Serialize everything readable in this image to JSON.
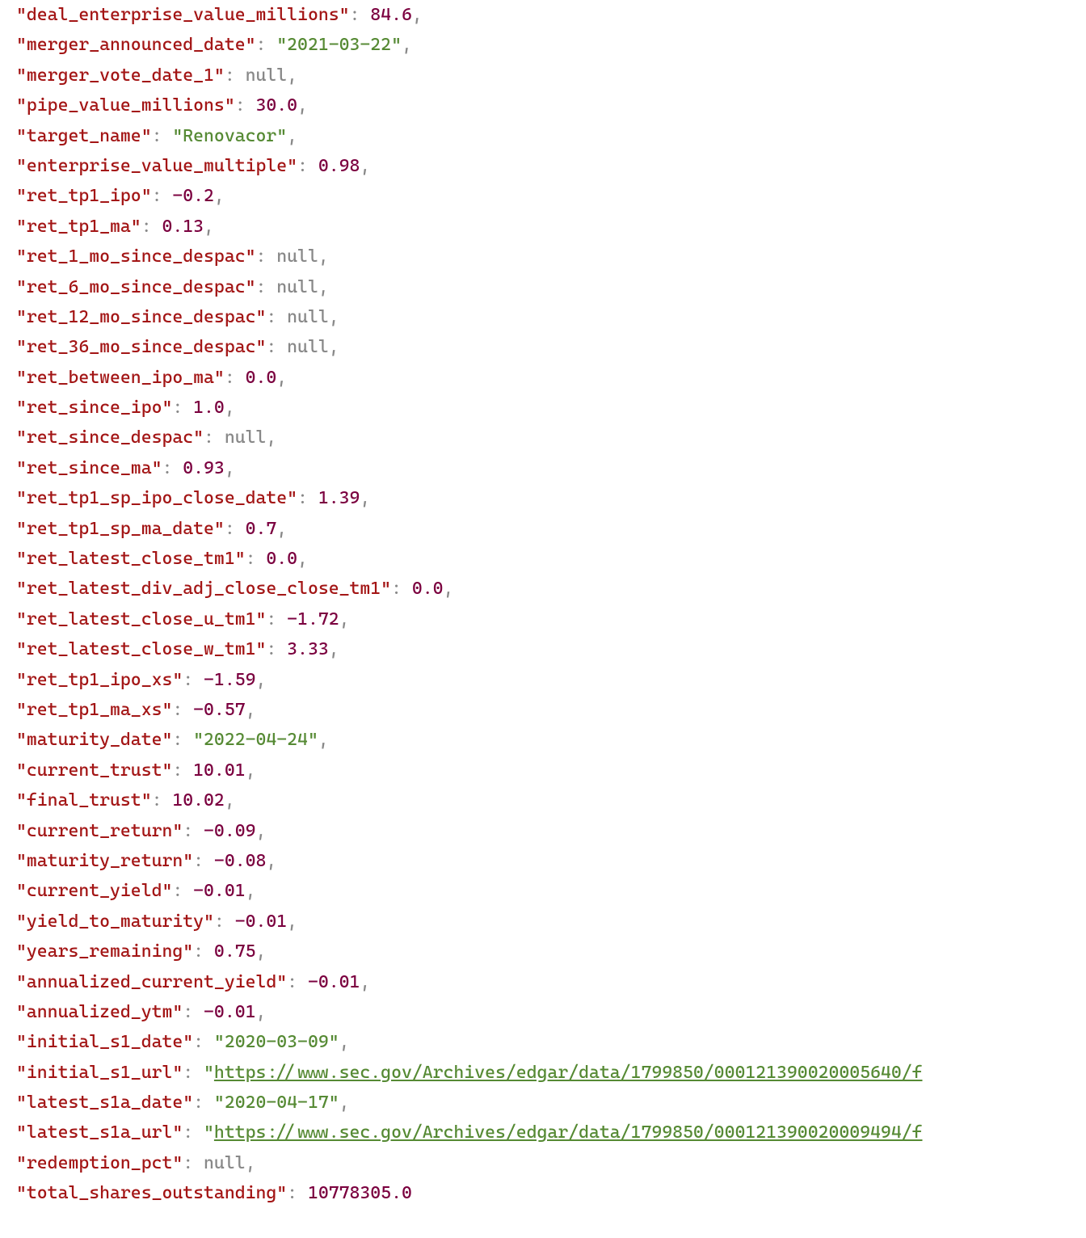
{
  "entries": [
    {
      "key": "deal_enterprise_value_millions",
      "type": "num",
      "value": "84.6",
      "comma": true
    },
    {
      "key": "merger_announced_date",
      "type": "str",
      "value": "2021-03-22",
      "comma": true
    },
    {
      "key": "merger_vote_date_1",
      "type": "null",
      "value": "null",
      "comma": true
    },
    {
      "key": "pipe_value_millions",
      "type": "num",
      "value": "30.0",
      "comma": true
    },
    {
      "key": "target_name",
      "type": "str",
      "value": "Renovacor",
      "comma": true
    },
    {
      "key": "enterprise_value_multiple",
      "type": "num",
      "value": "0.98",
      "comma": true
    },
    {
      "key": "ret_tp1_ipo",
      "type": "num",
      "value": "-0.2",
      "comma": true
    },
    {
      "key": "ret_tp1_ma",
      "type": "num",
      "value": "0.13",
      "comma": true
    },
    {
      "key": "ret_1_mo_since_despac",
      "type": "null",
      "value": "null",
      "comma": true
    },
    {
      "key": "ret_6_mo_since_despac",
      "type": "null",
      "value": "null",
      "comma": true
    },
    {
      "key": "ret_12_mo_since_despac",
      "type": "null",
      "value": "null",
      "comma": true
    },
    {
      "key": "ret_36_mo_since_despac",
      "type": "null",
      "value": "null",
      "comma": true
    },
    {
      "key": "ret_between_ipo_ma",
      "type": "num",
      "value": "0.0",
      "comma": true
    },
    {
      "key": "ret_since_ipo",
      "type": "num",
      "value": "1.0",
      "comma": true
    },
    {
      "key": "ret_since_despac",
      "type": "null",
      "value": "null",
      "comma": true
    },
    {
      "key": "ret_since_ma",
      "type": "num",
      "value": "0.93",
      "comma": true
    },
    {
      "key": "ret_tp1_sp_ipo_close_date",
      "type": "num",
      "value": "1.39",
      "comma": true
    },
    {
      "key": "ret_tp1_sp_ma_date",
      "type": "num",
      "value": "0.7",
      "comma": true
    },
    {
      "key": "ret_latest_close_tm1",
      "type": "num",
      "value": "0.0",
      "comma": true
    },
    {
      "key": "ret_latest_div_adj_close_close_tm1",
      "type": "num",
      "value": "0.0",
      "comma": true
    },
    {
      "key": "ret_latest_close_u_tm1",
      "type": "num",
      "value": "-1.72",
      "comma": true
    },
    {
      "key": "ret_latest_close_w_tm1",
      "type": "num",
      "value": "3.33",
      "comma": true
    },
    {
      "key": "ret_tp1_ipo_xs",
      "type": "num",
      "value": "-1.59",
      "comma": true
    },
    {
      "key": "ret_tp1_ma_xs",
      "type": "num",
      "value": "-0.57",
      "comma": true
    },
    {
      "key": "maturity_date",
      "type": "str",
      "value": "2022-04-24",
      "comma": true
    },
    {
      "key": "current_trust",
      "type": "num",
      "value": "10.01",
      "comma": true
    },
    {
      "key": "final_trust",
      "type": "num",
      "value": "10.02",
      "comma": true
    },
    {
      "key": "current_return",
      "type": "num",
      "value": "-0.09",
      "comma": true
    },
    {
      "key": "maturity_return",
      "type": "num",
      "value": "-0.08",
      "comma": true
    },
    {
      "key": "current_yield",
      "type": "num",
      "value": "-0.01",
      "comma": true
    },
    {
      "key": "yield_to_maturity",
      "type": "num",
      "value": "-0.01",
      "comma": true
    },
    {
      "key": "years_remaining",
      "type": "num",
      "value": "0.75",
      "comma": true
    },
    {
      "key": "annualized_current_yield",
      "type": "num",
      "value": "-0.01",
      "comma": true
    },
    {
      "key": "annualized_ytm",
      "type": "num",
      "value": "-0.01",
      "comma": true
    },
    {
      "key": "initial_s1_date",
      "type": "str",
      "value": "2020-03-09",
      "comma": true
    },
    {
      "key": "initial_s1_url",
      "type": "link",
      "value": "https://www.sec.gov/Archives/edgar/data/1799850/000121390020005640/f",
      "comma": false
    },
    {
      "key": "latest_s1a_date",
      "type": "str",
      "value": "2020-04-17",
      "comma": true
    },
    {
      "key": "latest_s1a_url",
      "type": "link",
      "value": "https://www.sec.gov/Archives/edgar/data/1799850/000121390020009494/f",
      "comma": false
    },
    {
      "key": "redemption_pct",
      "type": "null",
      "value": "null",
      "comma": true
    },
    {
      "key": "total_shares_outstanding",
      "type": "num",
      "value": "10778305.0",
      "comma": false
    }
  ]
}
